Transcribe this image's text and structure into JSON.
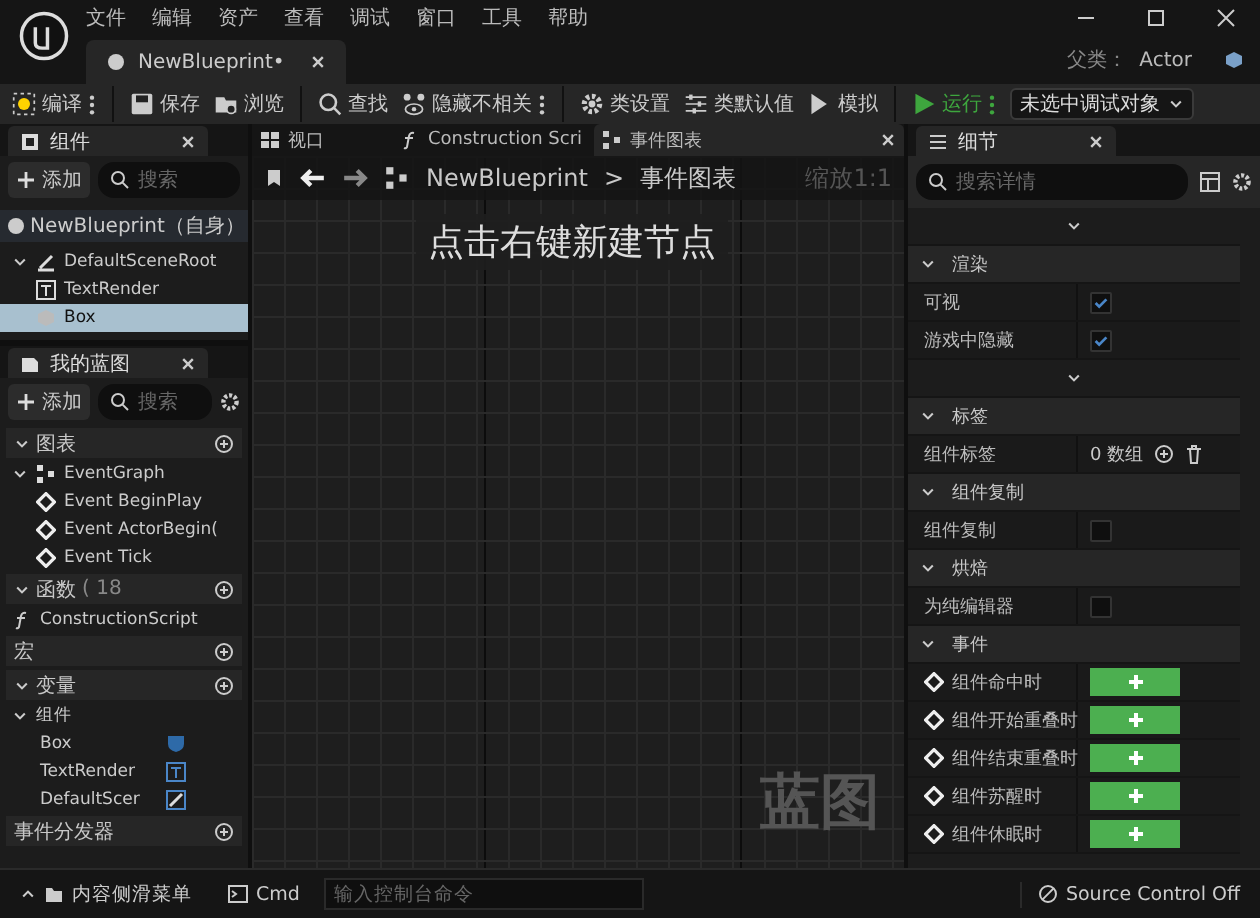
{
  "menu": [
    "文件",
    "编辑",
    "资产",
    "查看",
    "调试",
    "窗口",
    "工具",
    "帮助"
  ],
  "document_tab": {
    "label": "NewBlueprint•",
    "selected": true
  },
  "parent_class": {
    "label": "父类：",
    "value": "Actor"
  },
  "toolbar": [
    {
      "label": "编译",
      "kind": "compile",
      "more": true
    },
    {
      "label": "保存",
      "kind": "save",
      "more": false
    },
    {
      "label": "浏览",
      "kind": "browse",
      "more": false
    },
    {
      "label": "查找",
      "kind": "find",
      "more": false
    },
    {
      "label": "隐藏不相关",
      "kind": "hide",
      "more": true
    },
    {
      "label": "类设置",
      "kind": "settings",
      "more": false
    },
    {
      "label": "类默认值",
      "kind": "defaults",
      "more": false
    },
    {
      "label": "模拟",
      "kind": "simulate",
      "more": false
    },
    {
      "label": "运行",
      "kind": "play",
      "more": true
    }
  ],
  "debug_target": "未选中调试对象",
  "components_panel": {
    "title": "组件",
    "add": "添加",
    "search_placeholder": "搜索",
    "tree": [
      {
        "label": "NewBlueprint（自身）",
        "kind": "self",
        "selected": false
      },
      {
        "label": "DefaultSceneRoot",
        "kind": "scene",
        "selected": false,
        "expanded": true,
        "children": [
          {
            "label": "TextRender",
            "kind": "text",
            "selected": false
          },
          {
            "label": "Box",
            "kind": "box",
            "selected": true
          }
        ]
      }
    ]
  },
  "my_blueprint": {
    "title": "我的蓝图",
    "add": "添加",
    "search_placeholder": "搜索",
    "sections": [
      {
        "label": "图表",
        "expanded": true,
        "items": [
          {
            "label": "EventGraph",
            "kind": "graph",
            "expanded": true,
            "children": [
              {
                "label": "Event BeginPlay",
                "kind": "event"
              },
              {
                "label": "Event ActorBegin(",
                "kind": "event"
              },
              {
                "label": "Event Tick",
                "kind": "event"
              }
            ]
          }
        ]
      },
      {
        "label": "函数",
        "note": "( 18",
        "expanded": true,
        "items": [
          {
            "label": "ConstructionScript",
            "kind": "function"
          }
        ]
      },
      {
        "label": "宏"
      },
      {
        "label": "变量",
        "expanded": true,
        "items": [
          {
            "label": "组件",
            "kind": "group",
            "expanded": true,
            "children": [
              {
                "label": "Box",
                "kind": "box-var"
              },
              {
                "label": "TextRender",
                "kind": "text-var"
              },
              {
                "label": "DefaultScer",
                "kind": "scene-var"
              }
            ]
          }
        ]
      },
      {
        "label": "事件分发器"
      }
    ]
  },
  "graph_tabs": [
    {
      "label": "视口",
      "kind": "viewport",
      "selected": false
    },
    {
      "label": "Construction Scri",
      "kind": "function",
      "selected": false
    },
    {
      "label": "事件图表",
      "kind": "graph",
      "selected": true
    }
  ],
  "breadcrumb": {
    "root": "NewBlueprint",
    "separator": ">",
    "current": "事件图表"
  },
  "zoom": "缩放1:1",
  "hint": "点击右键新建节点",
  "graph_label": "蓝图",
  "details": {
    "title": "细节",
    "search_placeholder": "搜索详情",
    "rows": [
      {
        "kind": "chevron"
      },
      {
        "kind": "section",
        "label": "渲染"
      },
      {
        "kind": "checkbox",
        "label": "可视",
        "checked": true
      },
      {
        "kind": "checkbox",
        "label": "游戏中隐藏",
        "checked": true
      },
      {
        "kind": "chevron"
      },
      {
        "kind": "section",
        "label": "标签"
      },
      {
        "kind": "array",
        "label": "组件标签",
        "value": "0 数组"
      },
      {
        "kind": "section",
        "label": "组件复制"
      },
      {
        "kind": "checkbox",
        "label": "组件复制",
        "checked": false
      },
      {
        "kind": "section",
        "label": "烘焙"
      },
      {
        "kind": "checkbox",
        "label": "为纯编辑器",
        "checked": false
      },
      {
        "kind": "section",
        "label": "事件"
      },
      {
        "kind": "event",
        "label": "组件命中时"
      },
      {
        "kind": "event",
        "label": "组件开始重叠时"
      },
      {
        "kind": "event",
        "label": "组件结束重叠时"
      },
      {
        "kind": "event",
        "label": "组件苏醒时"
      },
      {
        "kind": "event",
        "label": "组件休眠时"
      }
    ]
  },
  "status_bar": {
    "drawer": "内容侧滑菜单",
    "cmd": "Cmd",
    "console_placeholder": "输入控制台命令",
    "source_control": "Source Control Off"
  }
}
